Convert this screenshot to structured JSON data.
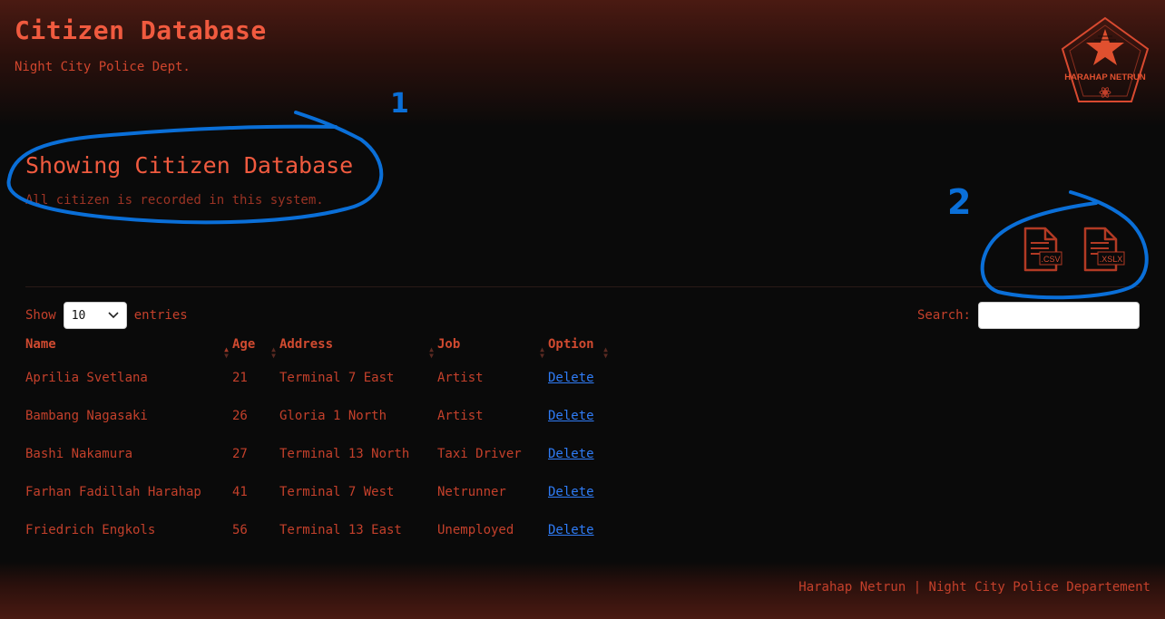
{
  "header": {
    "title": "Citizen Database",
    "subtitle": "Night City Police Dept.",
    "logo_text": "HARAHAP NETRUN"
  },
  "section": {
    "title": "Showing Citizen Database",
    "description": "All citizen is recorded in this system."
  },
  "export": {
    "csv_label": ".CSV",
    "xslx_label": ".XSLX"
  },
  "table_controls": {
    "show_label": "Show",
    "entries_value": "10",
    "entries_label": "entries",
    "search_label": "Search:",
    "search_value": ""
  },
  "table": {
    "columns": [
      "Name",
      "Age",
      "Address",
      "Job",
      "Option"
    ],
    "rows": [
      {
        "name": "Aprilia Svetlana",
        "age": "21",
        "address": "Terminal 7 East",
        "job": "Artist",
        "option": "Delete"
      },
      {
        "name": "Bambang Nagasaki",
        "age": "26",
        "address": "Gloria 1 North",
        "job": "Artist",
        "option": "Delete"
      },
      {
        "name": "Bashi Nakamura",
        "age": "27",
        "address": "Terminal 13 North",
        "job": "Taxi Driver",
        "option": "Delete"
      },
      {
        "name": "Farhan Fadillah Harahap",
        "age": "41",
        "address": "Terminal 7 West",
        "job": "Netrunner",
        "option": "Delete"
      },
      {
        "name": "Friedrich Engkols",
        "age": "56",
        "address": "Terminal 13 East",
        "job": "Unemployed",
        "option": "Delete"
      }
    ]
  },
  "annotations": {
    "mark_1": "1",
    "mark_2": "2"
  },
  "footer": {
    "text": "Harahap Netrun | Night City Police Departement"
  },
  "colors": {
    "accent": "#f05a3f",
    "text": "#c4402b",
    "link": "#2f7cf6",
    "annotation": "#0a6fd8",
    "background": "#0a0a0a"
  }
}
